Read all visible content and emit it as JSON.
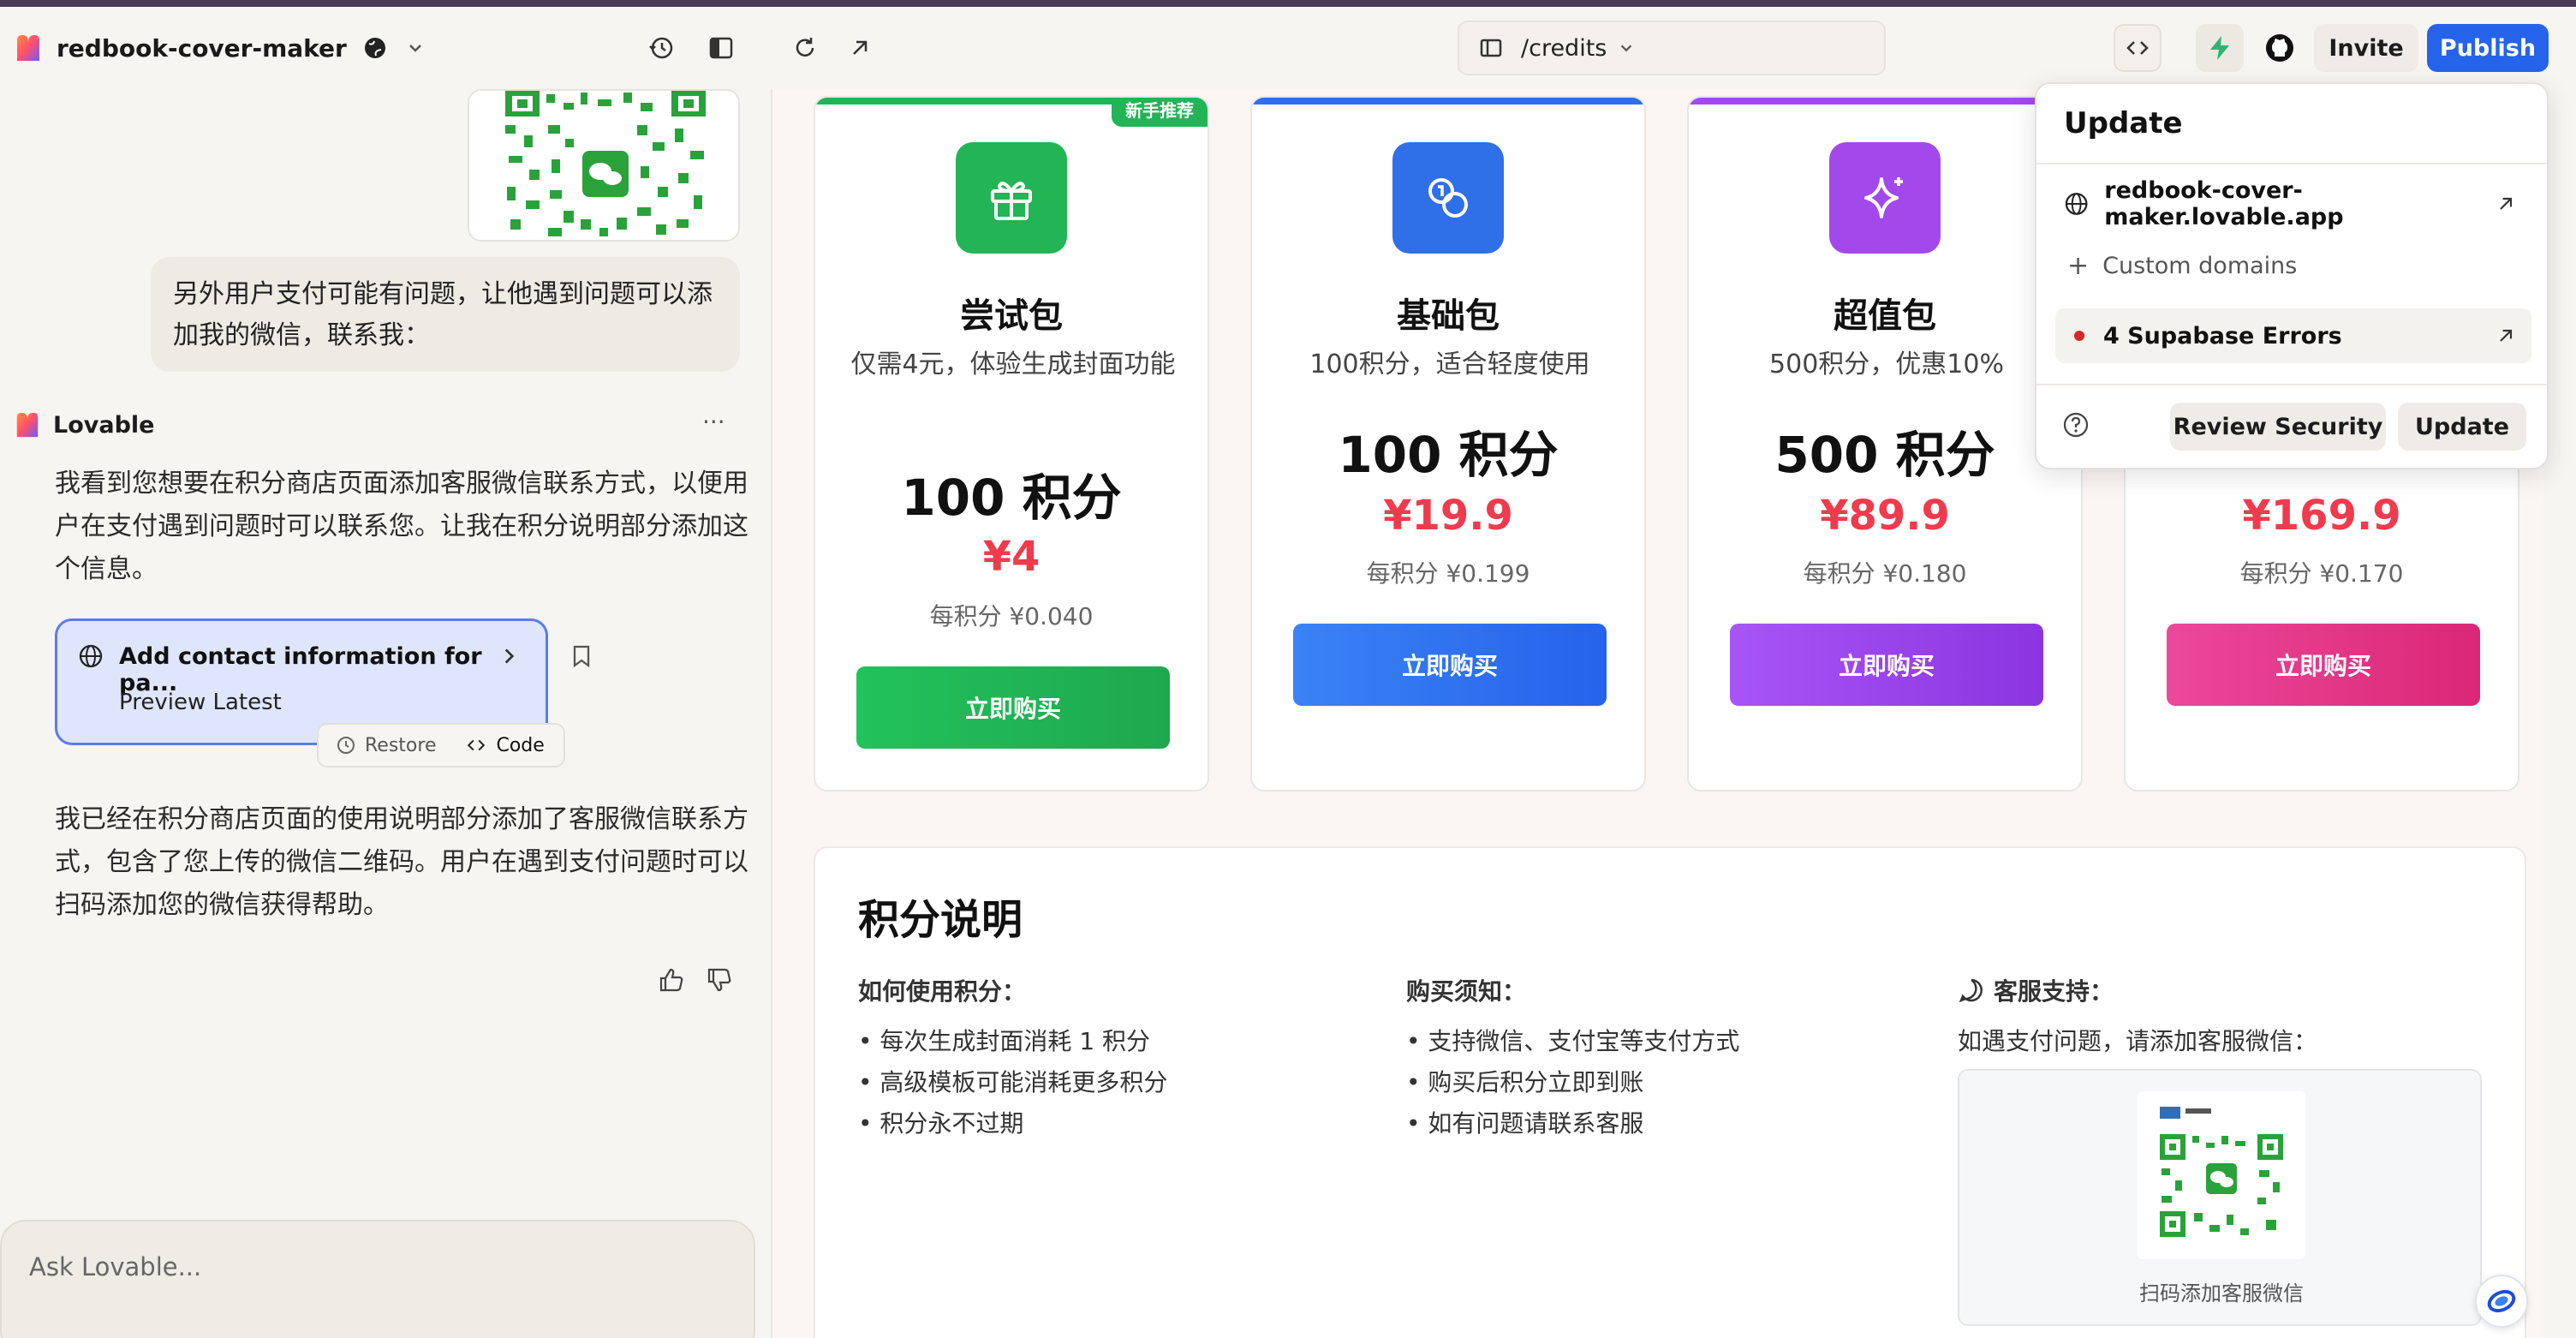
{
  "topbar": {
    "project_name": "redbook-cover-maker",
    "url_path": "/credits",
    "invite_label": "Invite",
    "publish_label": "Publish"
  },
  "chat": {
    "user_message": "另外用户支付可能有问题，让他遇到问题可以添加我的微信，联系我：",
    "assistant_name": "Lovable",
    "assistant_more": "···",
    "assistant_intro": "我看到您想要在积分商店页面添加客服微信联系方式，以便用户在支付遇到问题时可以联系您。让我在积分说明部分添加这个信息。",
    "edit_card": {
      "title": "Add contact information for pa...",
      "subtitle": "Preview Latest",
      "restore_label": "Restore",
      "code_label": "Code"
    },
    "assistant_result": "我已经在积分商店页面的使用说明部分添加了客服微信联系方式，包含了您上传的微信二维码。用户在遇到支付问题时可以扫码添加您的微信获得帮助。",
    "input_placeholder": "Ask Lovable..."
  },
  "packages": [
    {
      "name": "尝试包",
      "desc": "仅需4元，体验生成封面功能",
      "points": "100 积分",
      "price": "¥4",
      "unit_price": "每积分 ¥0.040",
      "buy_label": "立即购买",
      "badge": "新手推荐",
      "color": "#22b455"
    },
    {
      "name": "基础包",
      "desc": "100积分，适合轻度使用",
      "points": "100 积分",
      "price": "¥19.9",
      "unit_price": "每积分 ¥0.199",
      "buy_label": "立即购买",
      "color": "#2f6fe8"
    },
    {
      "name": "超值包",
      "desc": "500积分，优惠10%",
      "points": "500 积分",
      "price": "¥89.9",
      "unit_price": "每积分 ¥0.180",
      "buy_label": "立即购买",
      "color": "#a349ec"
    },
    {
      "name": "",
      "desc": "",
      "points": "",
      "price": "¥169.9",
      "unit_price": "每积分 ¥0.170",
      "buy_label": "立即购买",
      "color": "#e83c86"
    }
  ],
  "info": {
    "title": "积分说明",
    "how_to_use_title": "如何使用积分：",
    "how_to_use": [
      "• 每次生成封面消耗 1 积分",
      "• 高级模板可能消耗更多积分",
      "• 积分永不过期"
    ],
    "purchase_title": "购买须知：",
    "purchase": [
      "• 支持微信、支付宝等支付方式",
      "• 购买后积分立即到账",
      "• 如有问题请联系客服"
    ],
    "support_title": "客服支持：",
    "support_text": "如遇支付问题，请添加客服微信：",
    "qr_caption": "扫码添加客服微信"
  },
  "popup": {
    "title": "Update",
    "domain": "redbook-cover-maker.lovable.app",
    "custom_domains": "Custom domains",
    "errors": "4 Supabase Errors",
    "review_security": "Review Security",
    "update": "Update"
  }
}
